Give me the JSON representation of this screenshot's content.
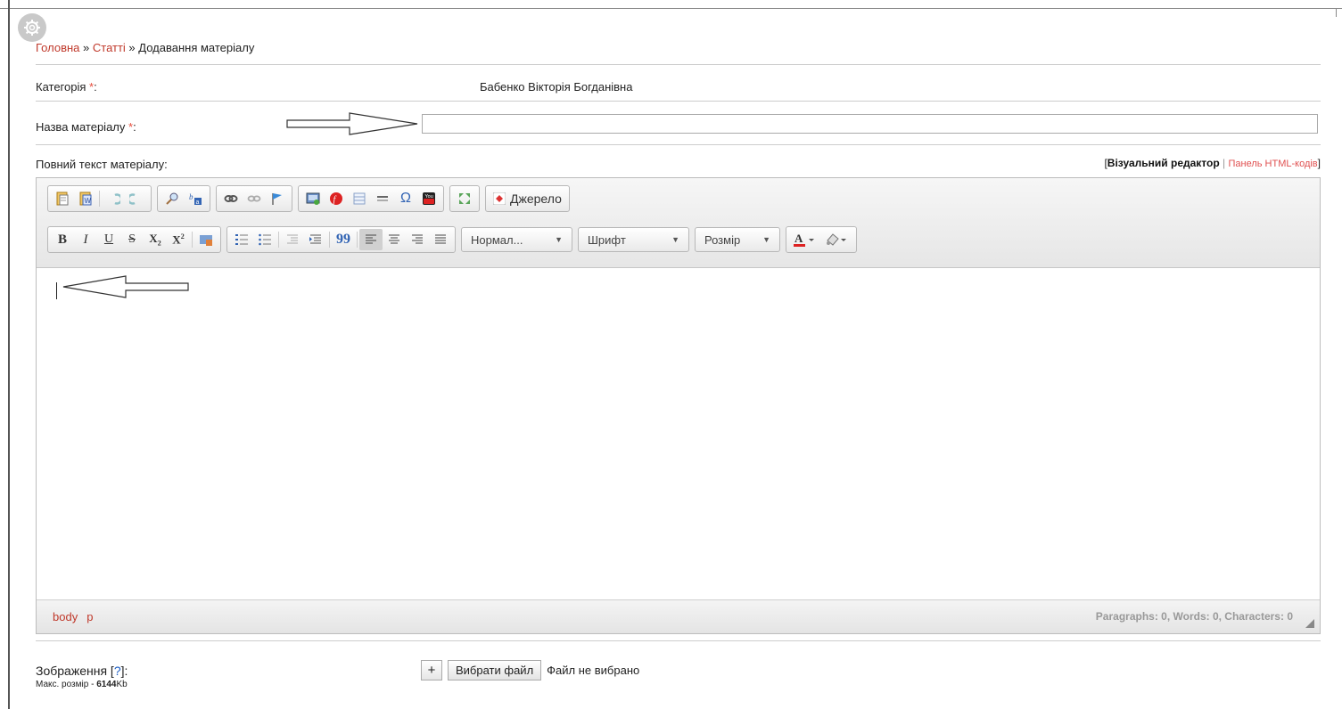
{
  "breadcrumb": {
    "home": "Головна",
    "sep1": " » ",
    "section": "Статті",
    "sep2": " » ",
    "current": "Додавання матеріалу"
  },
  "category": {
    "label": "Категорія ",
    "required_mark": "*",
    "colon": ":",
    "value": "Бабенко Вікторія Богданівна"
  },
  "title_field": {
    "label": "Назва матеріалу ",
    "required_mark": "*",
    "colon": ":",
    "value": ""
  },
  "fulltext": {
    "label": "Повний текст матеріалу:",
    "mode_open": "[",
    "visual_editor": "Візуальний редактор",
    "mode_sep": " | ",
    "html_panel": "Панель HTML-кодів",
    "mode_close": "]"
  },
  "toolbar": {
    "source_label": "Джерело",
    "format_combo": "Нормал...",
    "font_combo": "Шрифт",
    "size_combo": "Розмір",
    "bold": "B",
    "italic": "I",
    "underline": "U",
    "strike": "S",
    "subscript": "X",
    "superscript": "X",
    "blockquote": "99",
    "omega": "Ω"
  },
  "statusbar": {
    "path_body": "body",
    "path_p": "p",
    "counts": "Paragraphs: 0, Words: 0, Characters: 0"
  },
  "image_upload": {
    "label": "Зображення ",
    "help_open": "[",
    "help": "?",
    "help_close": "]:",
    "note_prefix": "Макс. розмір - ",
    "note_size": "6144",
    "note_unit": "Kb",
    "plus": "+",
    "choose_button": "Вибрати файл",
    "no_file": "Файл не вибрано"
  },
  "colors": {
    "link": "#c0392b",
    "required": "#e74c3c",
    "help": "#1a5cc4"
  }
}
